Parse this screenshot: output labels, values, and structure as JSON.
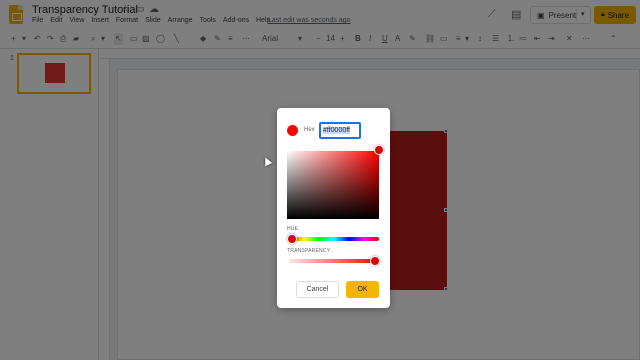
{
  "app": {
    "title": "Transparency Tutorial",
    "last_edit": "Last edit was seconds ago"
  },
  "menu": [
    "File",
    "Edit",
    "View",
    "Insert",
    "Format",
    "Slide",
    "Arrange",
    "Tools",
    "Add-ons",
    "Help"
  ],
  "header_buttons": {
    "present_label": "Present",
    "share_label": "Share"
  },
  "toolbar": {
    "font_name": "Arial",
    "font_size": "14"
  },
  "filmstrip": {
    "slide_number": "1"
  },
  "color_dialog": {
    "hex_label": "Hex",
    "hex_value": "#ff0000ff",
    "hue_label": "HUE",
    "transparency_label": "TRANSPARENCY",
    "transparency_value": 1.0,
    "selected_color": "#ff0000",
    "cancel_label": "Cancel",
    "ok_label": "OK"
  },
  "colors": {
    "accent": "#f4b400",
    "shape_fill": "#b71c1c",
    "focus": "#1a73e8"
  }
}
